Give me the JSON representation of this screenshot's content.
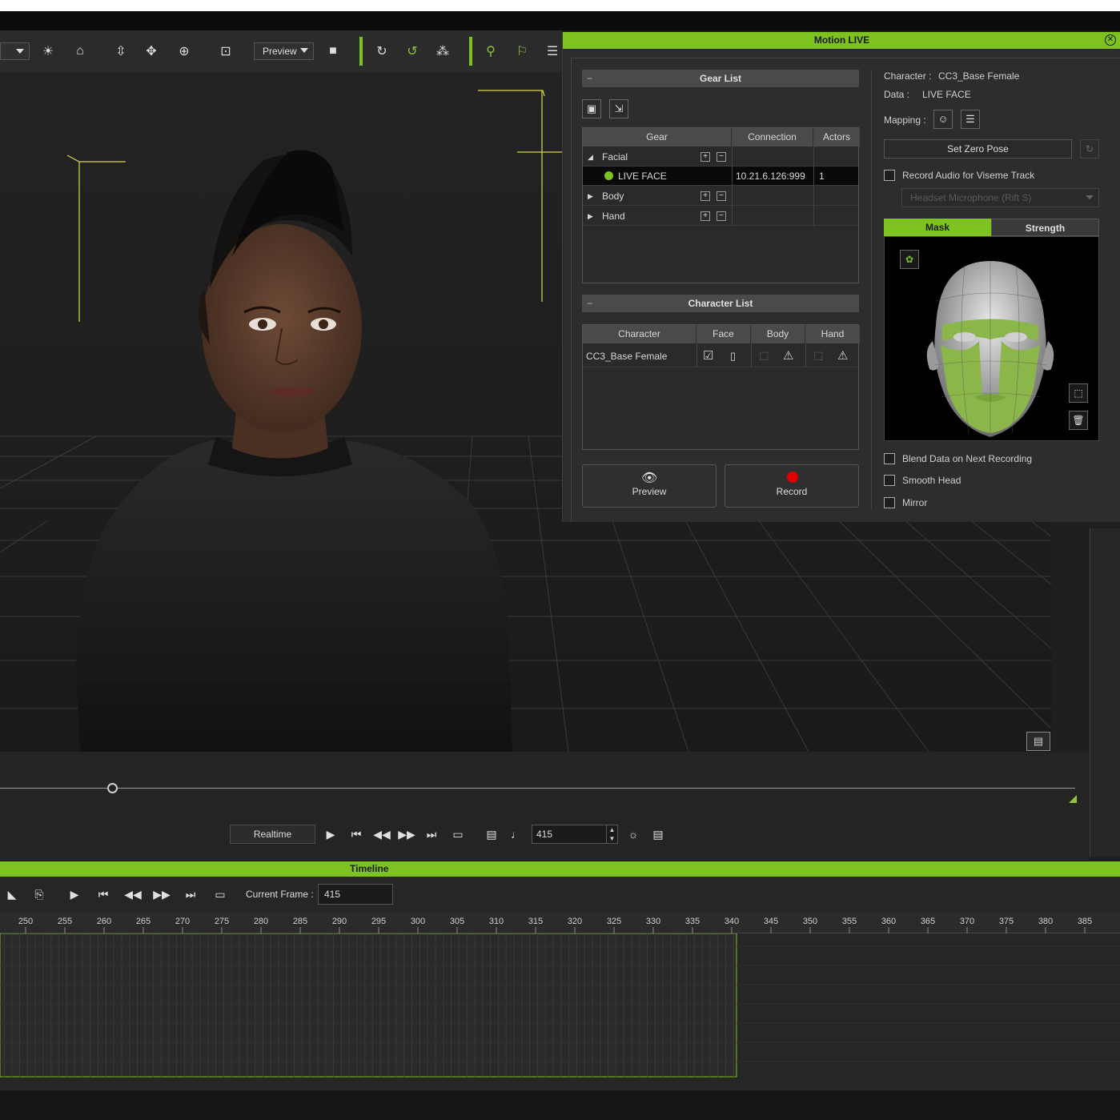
{
  "toolbar": {
    "preview_label": "Preview",
    "icons": [
      "dropdown-icon",
      "sun-icon",
      "home-icon",
      "fit-vertical-icon",
      "move-icon",
      "pivot-icon",
      "frame-icon",
      "camera-icon",
      "rotate-gizmo-icon",
      "green-rotate-icon",
      "particles-icon",
      "motion-pose-icon",
      "flag-icon",
      "clipboard-icon"
    ]
  },
  "motion_live": {
    "title": "Motion LIVE",
    "gear_list": {
      "header": "Gear List",
      "collapse": "−",
      "columns": [
        "Gear",
        "Connection",
        "Actors"
      ],
      "rows": [
        {
          "gear": "Facial",
          "connection": "",
          "actors": "",
          "expanded": true
        },
        {
          "gear": "LIVE FACE",
          "connection": "10.21.6.126:999",
          "actors": "1",
          "status_color": "#7dc21e"
        },
        {
          "gear": "Body",
          "connection": "",
          "actors": ""
        },
        {
          "gear": "Hand",
          "connection": "",
          "actors": ""
        }
      ]
    },
    "character_list": {
      "header": "Character List",
      "collapse": "−",
      "columns": [
        "Character",
        "Face",
        "Body",
        "Hand"
      ],
      "rows": [
        {
          "character": "CC3_Base Female"
        }
      ]
    },
    "preview_button": "Preview",
    "record_button": "Record",
    "info": {
      "character_label": "Character :",
      "character_value": "CC3_Base Female",
      "data_label": "Data :",
      "data_value": "LIVE FACE",
      "mapping_label": "Mapping :"
    },
    "set_zero_pose": "Set Zero Pose",
    "record_audio_label": "Record Audio for Viseme Track",
    "audio_device": "Headset Microphone (Rift S)",
    "tabs": [
      "Mask",
      "Strength"
    ],
    "options": [
      "Blend Data on Next Recording",
      "Smooth Head",
      "Mirror"
    ]
  },
  "playback": {
    "realtime_label": "Realtime",
    "frame_value": "415"
  },
  "timeline": {
    "title": "Timeline",
    "current_frame_label": "Current Frame :",
    "current_frame_value": "415",
    "ruler_ticks": [
      "250",
      "255",
      "260",
      "265",
      "270",
      "275",
      "280",
      "285",
      "290",
      "295",
      "300",
      "305",
      "310",
      "315",
      "320",
      "325",
      "330",
      "335",
      "340",
      "345",
      "350",
      "355",
      "360",
      "365",
      "370",
      "375",
      "380",
      "385"
    ]
  },
  "colors": {
    "accent": "#7dc21e",
    "record": "#e00000",
    "panel": "#2d2d2d"
  }
}
